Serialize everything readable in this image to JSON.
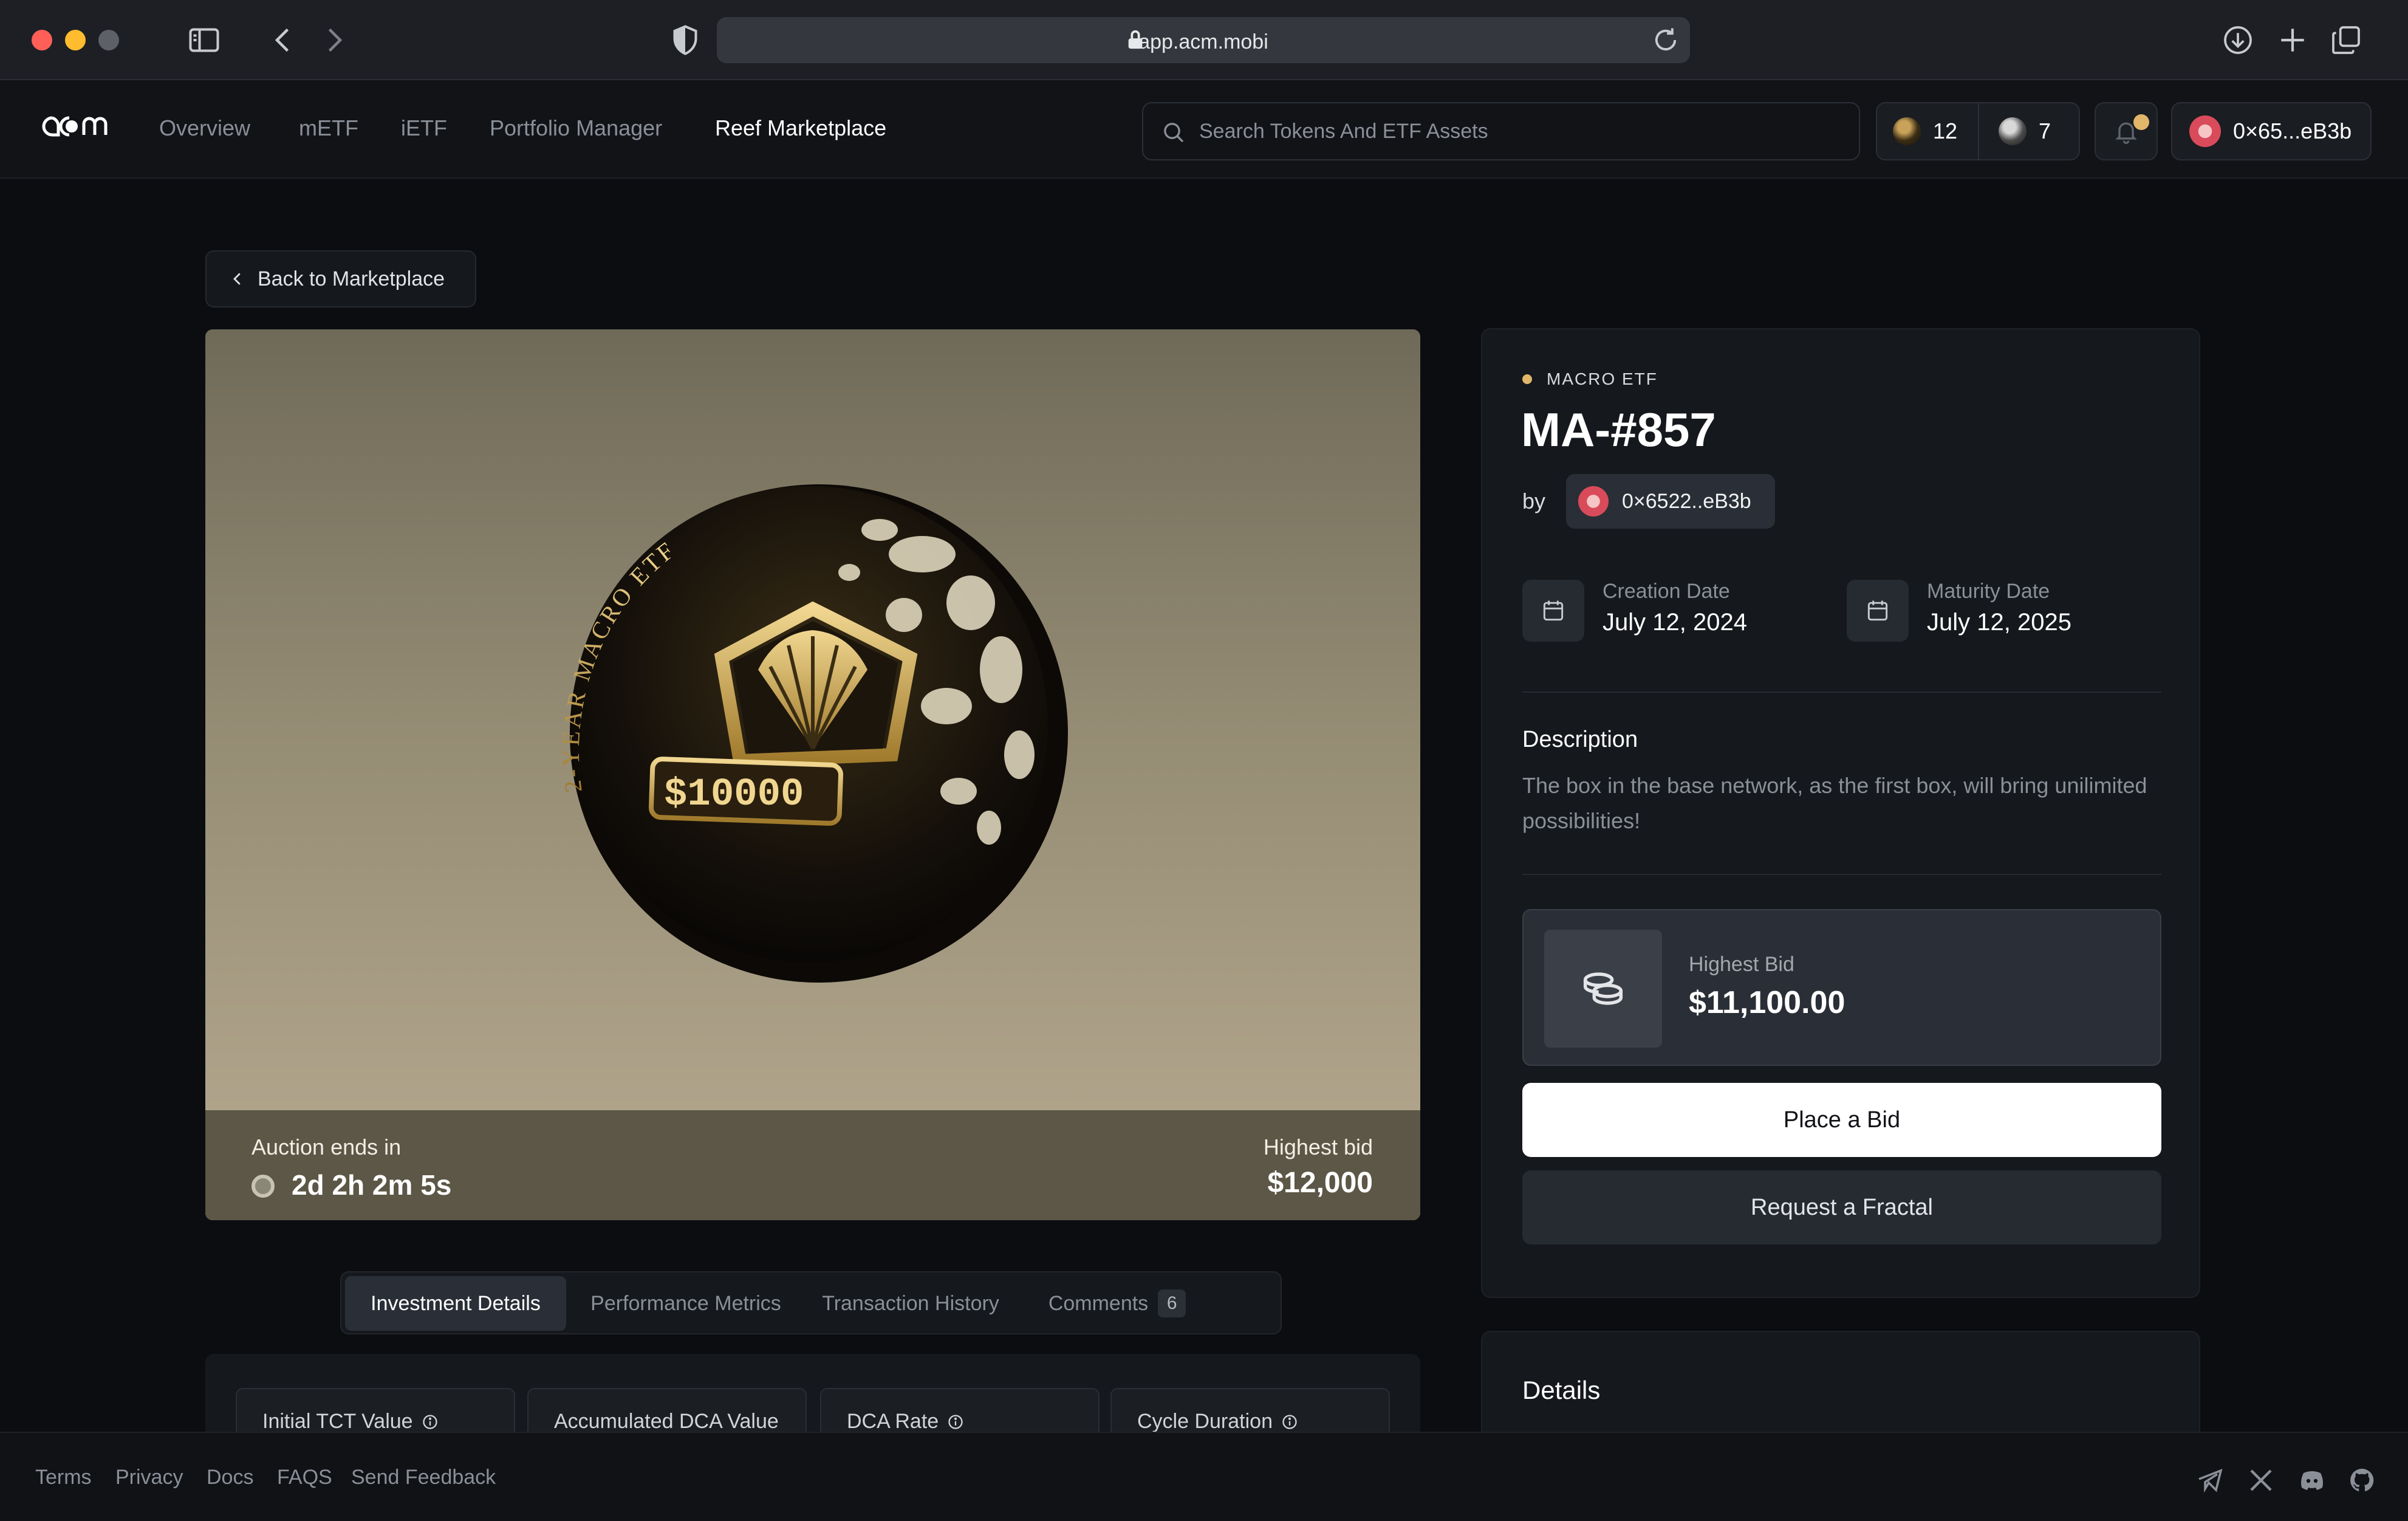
{
  "browser": {
    "url": "app.acm.mobi"
  },
  "nav": {
    "logo_text": "acm",
    "links": [
      "Overview",
      "mETF",
      "iETF",
      "Portfolio Manager",
      "Reef Marketplace"
    ],
    "active_link": "Reef Marketplace",
    "search_placeholder": "Search Tokens And ETF Assets",
    "token_a_count": "12",
    "token_b_count": "7",
    "notification_unread": true,
    "wallet": "0×65...eB3b"
  },
  "main": {
    "back_label": "Back to Marketplace",
    "hero": {
      "coin_text": {
        "ring": "2-YEAR MACRO ETF",
        "display": "$10000"
      },
      "auction_label": "Auction ends in",
      "auction_time": "2d 2h 2m 5s",
      "highest_bid_label": "Highest bid",
      "highest_bid_value": "$12,000"
    },
    "tabs": [
      {
        "label": "Investment Details",
        "active": true
      },
      {
        "label": "Performance Metrics",
        "active": false
      },
      {
        "label": "Transaction History",
        "active": false
      },
      {
        "label": "Comments",
        "active": false,
        "count": "6"
      }
    ],
    "metrics": [
      "Initial TCT Value",
      "Accumulated DCA Value",
      "DCA Rate",
      "Cycle Duration"
    ]
  },
  "side": {
    "tag": "MACRO ETF",
    "title": "MA-#857",
    "by_label": "by",
    "creator": "0×6522..eB3b",
    "creation_label": "Creation Date",
    "creation_value": "July 12, 2024",
    "maturity_label": "Maturity Date",
    "maturity_value": "July 12, 2025",
    "description_label": "Description",
    "description_text": "The box in the base network, as the first box, will bring unilimited possibilities!",
    "bid_label": "Highest Bid",
    "bid_value": "$11,100.00",
    "place_bid": "Place a Bid",
    "request_fractal": "Request a Fractal",
    "details_title": "Details"
  },
  "footer": {
    "links": [
      "Terms",
      "Privacy",
      "Docs",
      "FAQS",
      "Send Feedback"
    ],
    "social_icons": [
      "telegram-icon",
      "x-icon",
      "discord-icon",
      "github-icon"
    ]
  },
  "colors": {
    "background": "#0b0d11",
    "panel": "#15181c",
    "accent_gold": "#e2b66a",
    "muted_text": "#8a8f98"
  }
}
